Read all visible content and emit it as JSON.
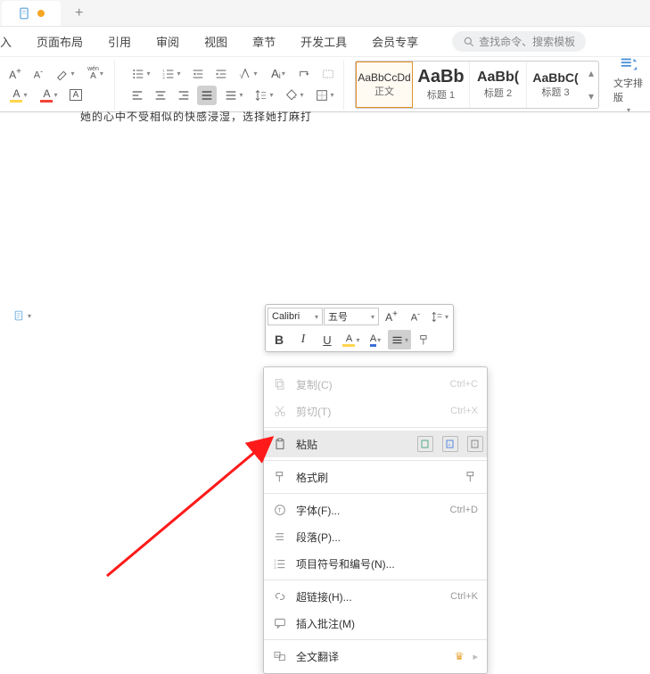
{
  "title_tab": {
    "doc_modified": true
  },
  "ribbon_tabs": [
    "入",
    "页面布局",
    "引用",
    "审阅",
    "视图",
    "章节",
    "开发工具",
    "会员专享"
  ],
  "search_placeholder": "查找命令、搜索模板",
  "style_gallery": [
    {
      "preview": "AaBbCcDd",
      "label": "正文"
    },
    {
      "preview": "AaBb",
      "label": "标题 1"
    },
    {
      "preview": "AaBb(",
      "label": "标题 2"
    },
    {
      "preview": "AaBbC(",
      "label": "标题 3"
    }
  ],
  "layout_btn_label": "文字排版",
  "ruby_label": "wén",
  "doc_snippet": "她的心中不受相似的快感浸湿，选择她打麻打",
  "mini_toolbar": {
    "font": "Calibri",
    "size": "五号"
  },
  "context_menu": {
    "copy": {
      "label": "复制(C)",
      "shortcut": "Ctrl+C"
    },
    "cut": {
      "label": "剪切(T)",
      "shortcut": "Ctrl+X"
    },
    "paste": {
      "label": "粘贴"
    },
    "format_painter": {
      "label": "格式刷"
    },
    "font": {
      "label": "字体(F)...",
      "shortcut": "Ctrl+D"
    },
    "paragraph": {
      "label": "段落(P)..."
    },
    "bullets": {
      "label": "项目符号和编号(N)..."
    },
    "hyperlink": {
      "label": "超链接(H)...",
      "shortcut": "Ctrl+K"
    },
    "comment": {
      "label": "插入批注(M)"
    },
    "translate": {
      "label": "全文翻译"
    }
  }
}
